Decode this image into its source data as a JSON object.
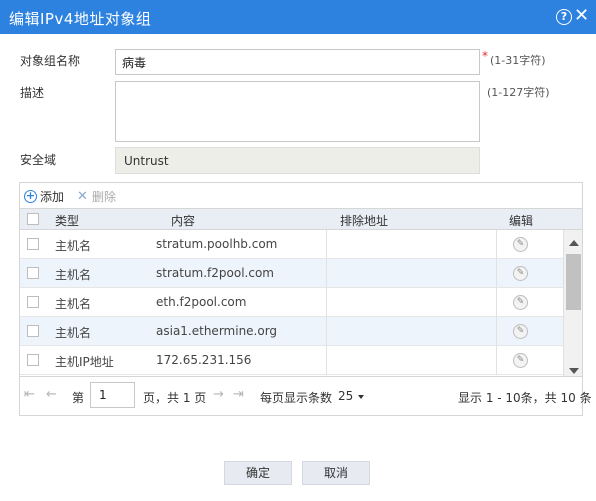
{
  "dialog": {
    "title": "编辑IPv4地址对象组",
    "help_label": "?",
    "close_label": "✕"
  },
  "form": {
    "name_label": "对象组名称",
    "name_value": "病毒",
    "name_required": "*",
    "name_hint": "(1-31字符)",
    "desc_label": "描述",
    "desc_value": "",
    "desc_hint": "(1-127字符)",
    "zone_label": "安全域",
    "zone_value": "Untrust"
  },
  "toolbar": {
    "add_label": "添加",
    "delete_label": "删除"
  },
  "table": {
    "columns": [
      "类型",
      "内容",
      "排除地址",
      "编辑"
    ],
    "rows": [
      {
        "type": "主机名",
        "content": "stratum.poolhb.com",
        "exclude": ""
      },
      {
        "type": "主机名",
        "content": "stratum.f2pool.com",
        "exclude": ""
      },
      {
        "type": "主机名",
        "content": "eth.f2pool.com",
        "exclude": ""
      },
      {
        "type": "主机名",
        "content": "asia1.ethermine.org",
        "exclude": ""
      },
      {
        "type": "主机IP地址",
        "content": "172.65.231.156",
        "exclude": ""
      }
    ]
  },
  "pager": {
    "page_prefix": "第",
    "page_value": "1",
    "page_suffix": "页，共 1 页",
    "page_size_label": "每页显示条数",
    "page_size_value": "25",
    "summary": "显示 1 - 10条，共 10 条"
  },
  "footer": {
    "ok_label": "确定",
    "cancel_label": "取消"
  }
}
